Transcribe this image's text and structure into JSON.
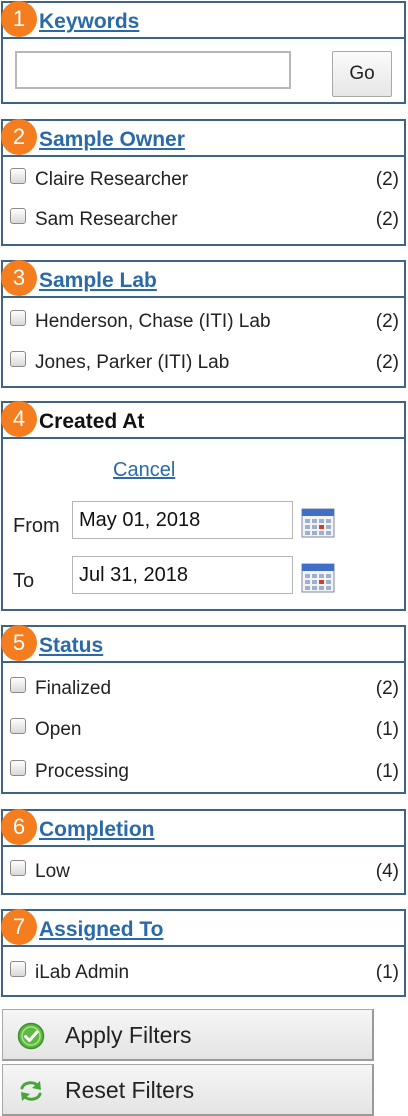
{
  "keywords": {
    "number": "1",
    "title": "Keywords",
    "input_value": "",
    "go_label": "Go"
  },
  "sample_owner": {
    "number": "2",
    "title": "Sample Owner",
    "items": [
      {
        "label": "Claire Researcher",
        "count": "(2)"
      },
      {
        "label": "Sam Researcher",
        "count": "(2)"
      }
    ]
  },
  "sample_lab": {
    "number": "3",
    "title": "Sample Lab",
    "items": [
      {
        "label": "Henderson, Chase (ITI) Lab",
        "count": "(2)"
      },
      {
        "label": "Jones, Parker (ITI) Lab",
        "count": "(2)"
      }
    ]
  },
  "created_at": {
    "number": "4",
    "title": "Created At",
    "cancel_label": "Cancel",
    "from_label": "From",
    "from_value": "May 01, 2018",
    "to_label": "To",
    "to_value": "Jul 31, 2018",
    "calendar_icon": "calendar-icon"
  },
  "status": {
    "number": "5",
    "title": "Status",
    "items": [
      {
        "label": "Finalized",
        "count": "(2)"
      },
      {
        "label": "Open",
        "count": "(1)"
      },
      {
        "label": "Processing",
        "count": "(1)"
      }
    ]
  },
  "completion": {
    "number": "6",
    "title": "Completion",
    "items": [
      {
        "label": "Low",
        "count": "(4)"
      }
    ]
  },
  "assigned_to": {
    "number": "7",
    "title": "Assigned To",
    "items": [
      {
        "label": "iLab Admin",
        "count": "(1)"
      }
    ]
  },
  "actions": {
    "apply_label": "Apply Filters",
    "apply_icon": "check-circle-icon",
    "reset_label": "Reset Filters",
    "reset_icon": "refresh-arrows-icon"
  },
  "colors": {
    "accent_orange": "#f47d20",
    "link_blue": "#2a6aa8",
    "border_navy": "#3d6389"
  }
}
